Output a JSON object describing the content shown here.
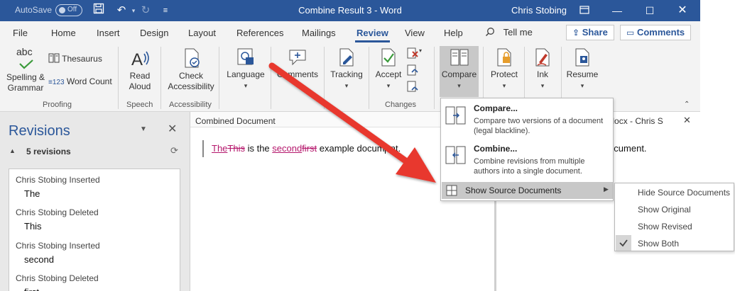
{
  "window": {
    "autosave_label": "AutoSave",
    "autosave_state": "Off",
    "title": "Combine Result 3 - Word",
    "user": "Chris Stobing"
  },
  "tabs": [
    "File",
    "Home",
    "Insert",
    "Design",
    "Layout",
    "References",
    "Mailings",
    "Review",
    "View",
    "Help"
  ],
  "active_tab": "Review",
  "tell_me": "Tell me",
  "share_label": "Share",
  "comments_label": "Comments",
  "ribbon": {
    "spelling": "Spelling &",
    "grammar": "Grammar",
    "spelling_icon_text": "abc",
    "thesaurus": "Thesaurus",
    "word_count": "Word Count",
    "read": "Read",
    "aloud": "Aloud",
    "check": "Check",
    "accessibility": "Accessibility",
    "language": "Language",
    "comments": "Comments",
    "tracking": "Tracking",
    "accept": "Accept",
    "compare": "Compare",
    "protect": "Protect",
    "ink": "Ink",
    "resume": "Resume",
    "groups": {
      "proofing": "Proofing",
      "speech": "Speech",
      "accessibility": "Accessibility",
      "changes": "Changes"
    }
  },
  "revisions": {
    "title": "Revisions",
    "count": "5 revisions",
    "items": [
      {
        "header": "Chris Stobing Inserted",
        "value": "The"
      },
      {
        "header": "Chris Stobing Deleted",
        "value": "This"
      },
      {
        "header": "Chris Stobing Inserted",
        "value": "second"
      },
      {
        "header": "Chris Stobing Deleted",
        "value": "first"
      }
    ]
  },
  "document": {
    "label": "Combined Document",
    "ins1": "The",
    "del1": "This",
    "t1": " is the ",
    "ins2": "second",
    "del2": "first",
    "t2": " example docum",
    "t3": "ent."
  },
  "source": {
    "label": "ple.docx - Chris S",
    "text": "e document."
  },
  "compare_menu": {
    "compare_title": "Compare...",
    "compare_desc": "Compare two versions of a document (legal blackline).",
    "combine_title": "Combine...",
    "combine_desc": "Combine revisions from multiple authors into a single document.",
    "show_source": "Show Source Documents"
  },
  "source_submenu": [
    "Hide Source Documents",
    "Show Original",
    "Show Revised",
    "Show Both"
  ],
  "colors": {
    "word_blue": "#2b579a",
    "revision_pink": "#b5176c",
    "arrow_red": "#e8372f"
  }
}
